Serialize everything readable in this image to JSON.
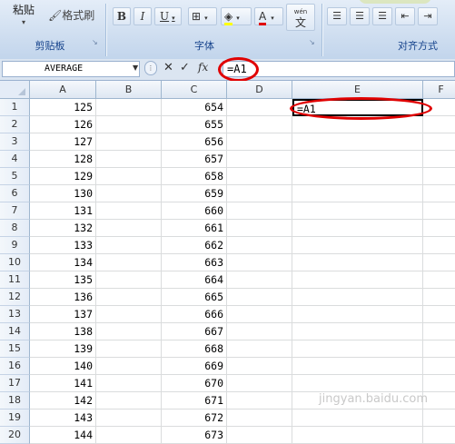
{
  "ribbon": {
    "paste_label": "粘贴",
    "format_painter_label": "格式刷",
    "clipboard_group": "剪贴板",
    "font_group": "字体",
    "align_group": "对齐方式",
    "bold": "B",
    "italic": "I",
    "underline": "U",
    "font_color": "A",
    "wen_glyph": "wén",
    "wen_char": "文"
  },
  "formula_bar": {
    "name_box": "AVERAGE",
    "cancel": "✕",
    "enter": "✓",
    "fx": "fx",
    "formula": "=A1"
  },
  "columns": [
    "A",
    "B",
    "C",
    "D",
    "E",
    "F"
  ],
  "rows": [
    {
      "n": "1",
      "a": "125",
      "c": "654"
    },
    {
      "n": "2",
      "a": "126",
      "c": "655"
    },
    {
      "n": "3",
      "a": "127",
      "c": "656"
    },
    {
      "n": "4",
      "a": "128",
      "c": "657"
    },
    {
      "n": "5",
      "a": "129",
      "c": "658"
    },
    {
      "n": "6",
      "a": "130",
      "c": "659"
    },
    {
      "n": "7",
      "a": "131",
      "c": "660"
    },
    {
      "n": "8",
      "a": "132",
      "c": "661"
    },
    {
      "n": "9",
      "a": "133",
      "c": "662"
    },
    {
      "n": "10",
      "a": "134",
      "c": "663"
    },
    {
      "n": "11",
      "a": "135",
      "c": "664"
    },
    {
      "n": "12",
      "a": "136",
      "c": "665"
    },
    {
      "n": "13",
      "a": "137",
      "c": "666"
    },
    {
      "n": "14",
      "a": "138",
      "c": "667"
    },
    {
      "n": "15",
      "a": "139",
      "c": "668"
    },
    {
      "n": "16",
      "a": "140",
      "c": "669"
    },
    {
      "n": "17",
      "a": "141",
      "c": "670"
    },
    {
      "n": "18",
      "a": "142",
      "c": "671"
    },
    {
      "n": "19",
      "a": "143",
      "c": "672"
    },
    {
      "n": "20",
      "a": "144",
      "c": "673"
    }
  ],
  "active_cell": {
    "ref": "E1",
    "value": "=A1"
  },
  "highlight_color": "#e00000",
  "watermark": "jingyan.baidu.com"
}
